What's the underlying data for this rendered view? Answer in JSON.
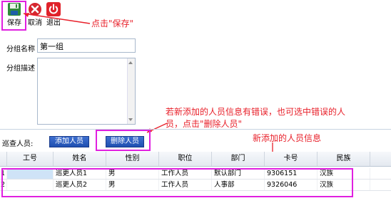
{
  "toolbar": {
    "save_label": "保存",
    "cancel_label": "取消",
    "exit_label": "退出"
  },
  "annotations": {
    "save_hint": "点击\"保存\"",
    "delete_hint_line1": "若新添加的人员信息有错误，也可选中错误的人",
    "delete_hint_line2": "员，点击\"删除人员\"",
    "new_info_hint": "新添加的人员信息"
  },
  "form": {
    "group_name_label": "分组名称",
    "group_name_value": "第一组",
    "group_desc_label": "分组描述",
    "group_desc_value": ""
  },
  "patrol": {
    "label": "巡查人员:",
    "add_button": "添加人员",
    "delete_button": "删除人员"
  },
  "table": {
    "columns": [
      "工号",
      "姓名",
      "性别",
      "职位",
      "部门",
      "卡号",
      "民族"
    ],
    "rows": [
      {
        "index": "1",
        "id": "",
        "name": "巡更人员1",
        "gender": "男",
        "position": "工作人员",
        "dept": "默认部门",
        "card": "9306151",
        "ethnicity": "汉族"
      },
      {
        "index": "2",
        "id": "",
        "name": "巡更人员2",
        "gender": "男",
        "position": "工作人员",
        "dept": "人事部",
        "card": "9326046",
        "ethnicity": "汉族"
      }
    ]
  },
  "colors": {
    "highlight": "#e020e0",
    "annotation": "#e8202a",
    "button_blue": "#2a5bc0"
  }
}
